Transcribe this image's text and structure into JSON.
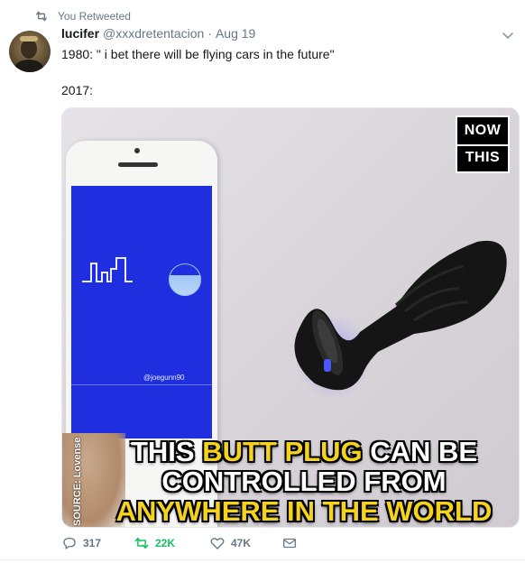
{
  "retweet_context": {
    "label": "You Retweeted",
    "icon": "retweet-icon"
  },
  "author": {
    "name": "lucifer",
    "handle": "@xxxdretentacion",
    "separator": "·",
    "date": "Aug 19"
  },
  "tweet": {
    "text": "1980: \" i bet there will be flying cars in the future\"\n\n2017:"
  },
  "media": {
    "logo_line1": "NOW",
    "logo_line2": "THIS",
    "source_credit": "SOURCE: Lovense",
    "phone_screen_credit": "@joegunn90",
    "caption_part1": "THIS ",
    "caption_highlight1": "BUTT PLUG",
    "caption_part2": " CAN BE",
    "caption_line2": "CONTROLLED FROM",
    "caption_highlight2": "ANYWHERE IN THE WORLD",
    "highlight_color": "#f5d21c"
  },
  "actions": {
    "reply_count": "317",
    "retweet_count": "22K",
    "like_count": "47K",
    "retweet_active_color": "#17bf63"
  }
}
